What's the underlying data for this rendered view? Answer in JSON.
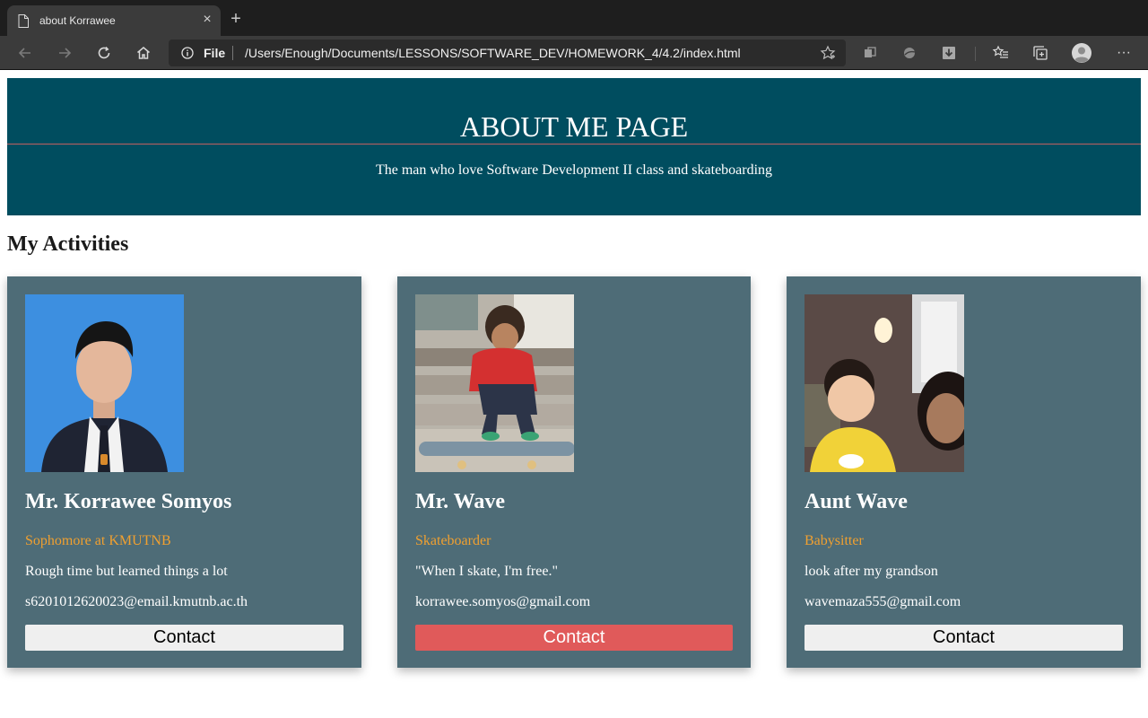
{
  "browser": {
    "tab_title": "about Korrawee",
    "new_tab_symbol": "+",
    "close_symbol": "×",
    "address_scheme": "File",
    "url": "/Users/Enough/Documents/LESSONS/SOFTWARE_DEV/HOMEWORK_4/4.2/index.html",
    "more_symbol": "···"
  },
  "header": {
    "title": "ABOUT ME PAGE",
    "tagline": "The man who love Software Development II class and skateboarding"
  },
  "section": {
    "title": "My Activities"
  },
  "cards": [
    {
      "name": "Mr. Korrawee Somyos",
      "role": "Sophomore at KMUTNB",
      "description": "Rough time but learned things a lot",
      "email": "s6201012620023@email.kmutnb.ac.th",
      "contact_label": "Contact"
    },
    {
      "name": "Mr. Wave",
      "role": "Skateboarder",
      "description": "\"When I skate, I'm free.\"",
      "email": "korrawee.somyos@gmail.com",
      "contact_label": "Contact"
    },
    {
      "name": "Aunt Wave",
      "role": "Babysitter",
      "description": "look after my grandson",
      "email": "wavemaza555@gmail.com",
      "contact_label": "Contact"
    }
  ],
  "colors": {
    "banner": "#004d5f",
    "card": "#4e6c77",
    "role_text": "#f0a030",
    "contact_active": "#e05a5a"
  }
}
